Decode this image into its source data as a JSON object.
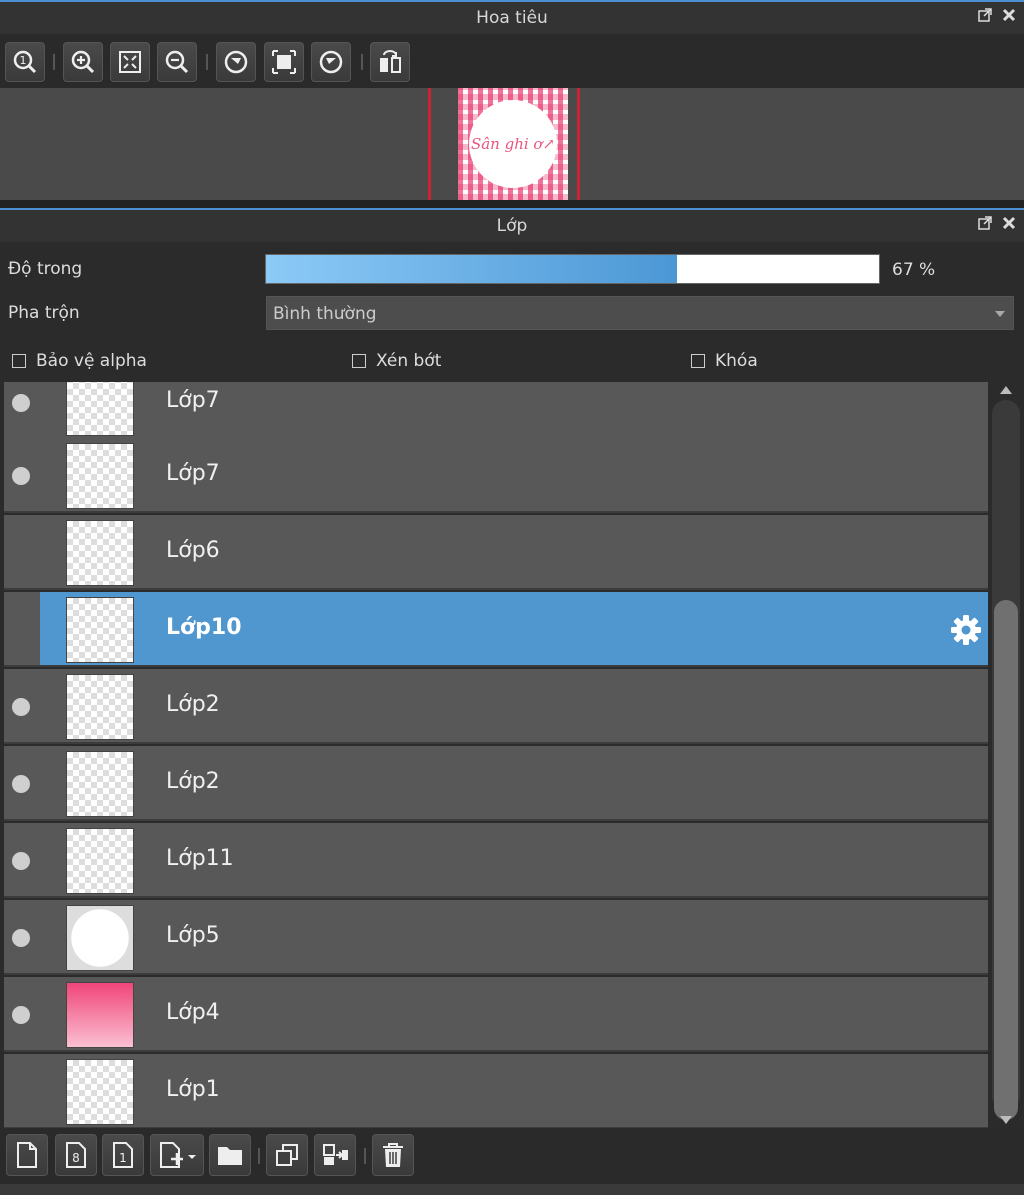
{
  "navigator": {
    "title": "Hoa tiêu",
    "thumb_text": "Sân ghi ơ↗",
    "toolbar": [
      "zoom-actual-icon",
      "zoom-in-icon",
      "fit-screen-icon",
      "zoom-out-icon",
      "rotate-left-icon",
      "fit-frame-icon",
      "rotate-right-icon",
      "flip-horizontal-icon"
    ]
  },
  "layers_panel": {
    "title": "Lớp",
    "opacity_label": "Độ trong",
    "opacity_value": "67 %",
    "opacity_percent": 67,
    "blend_label": "Pha trộn",
    "blend_value": "Bình thường",
    "checkboxes": {
      "protect_alpha": "Bảo vệ alpha",
      "clipping": "Xén bớt",
      "lock": "Khóa"
    },
    "layers": [
      {
        "name": "Lớp7",
        "visible": true
      },
      {
        "name": "Lớp7",
        "visible": true
      },
      {
        "name": "Lớp6",
        "visible": false
      },
      {
        "name": "Lớp10",
        "visible": false,
        "selected": true
      },
      {
        "name": "Lớp2",
        "visible": true
      },
      {
        "name": "Lớp2",
        "visible": true
      },
      {
        "name": "Lớp11",
        "visible": true
      },
      {
        "name": "Lớp5",
        "visible": true
      },
      {
        "name": "Lớp4",
        "visible": true
      },
      {
        "name": "Lớp1",
        "visible": false
      }
    ],
    "bottom_toolbar": [
      "new-layer-icon",
      "new-8bit-layer-icon",
      "new-1bit-layer-icon",
      "add-layer-menu-icon",
      "folder-icon",
      "duplicate-layer-icon",
      "merge-layer-icon",
      "delete-layer-icon"
    ]
  },
  "colors": {
    "accent": "#5096cf",
    "panel_bg": "#2b2b2b",
    "layer_bg": "#585858"
  }
}
